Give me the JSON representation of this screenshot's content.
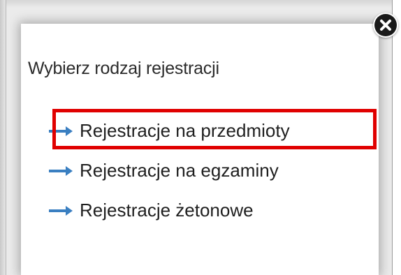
{
  "dialog": {
    "title": "Wybierz rodzaj rejestracji",
    "options": [
      {
        "label": "Rejestracje na przedmioty",
        "icon": "arrow-right-icon",
        "highlighted": true
      },
      {
        "label": "Rejestracje na egzaminy",
        "icon": "arrow-right-icon",
        "highlighted": false
      },
      {
        "label": "Rejestracje żetonowe",
        "icon": "arrow-right-icon",
        "highlighted": false
      }
    ],
    "close_icon": "close-icon"
  },
  "colors": {
    "arrow": "#3a7fc1",
    "highlight": "#e00000",
    "text": "#1f1f1f"
  }
}
